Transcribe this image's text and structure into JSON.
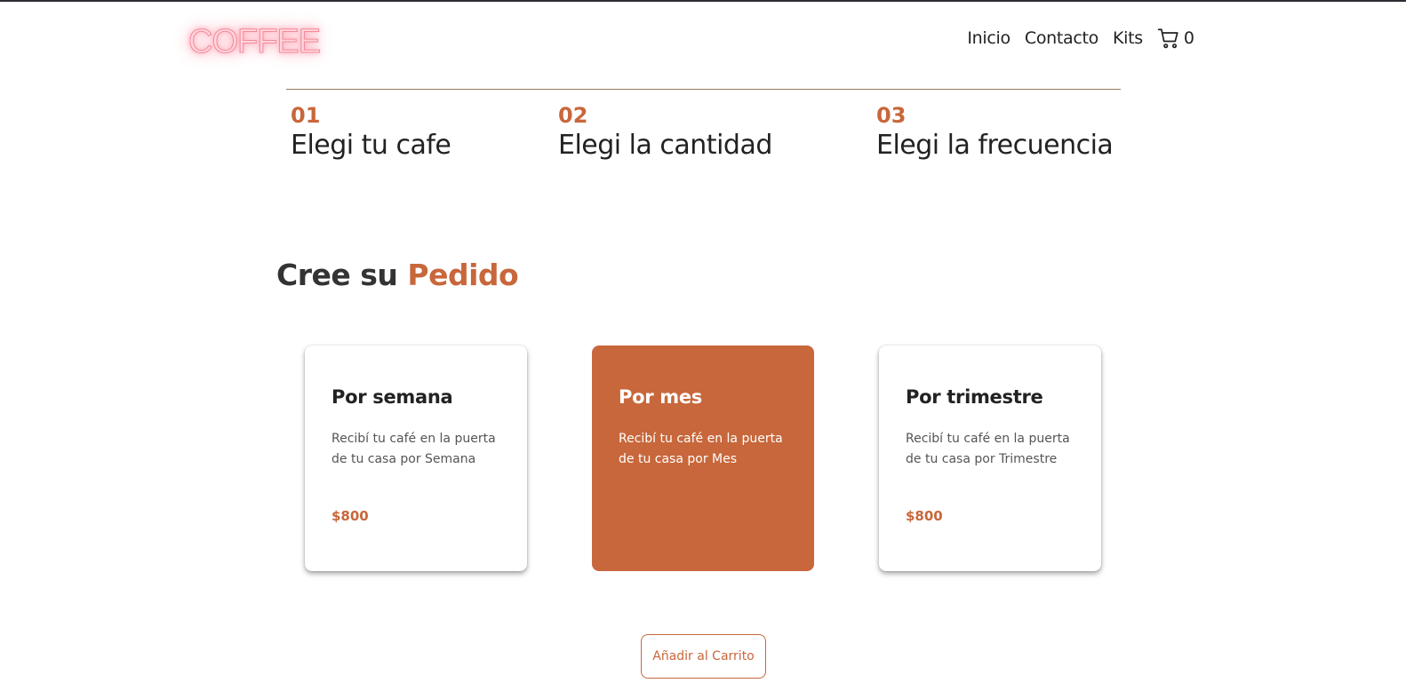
{
  "brand": {
    "logo_text": "COFFEE"
  },
  "nav": {
    "items": [
      {
        "label": "Inicio"
      },
      {
        "label": "Contacto"
      },
      {
        "label": "Kits"
      }
    ],
    "cart_icon": "shopping-cart-icon",
    "cart_count": "0"
  },
  "steps": [
    {
      "num": "01",
      "title": "Elegi tu cafe"
    },
    {
      "num": "02",
      "title": "Elegi la cantidad"
    },
    {
      "num": "03",
      "title": "Elegi la frecuencia"
    }
  ],
  "order_heading": {
    "prefix": "Cree su",
    "accent": "Pedido"
  },
  "plans": [
    {
      "title": "Por semana",
      "desc": "Recibí tu café en la puerta de tu casa por Semana",
      "price": "$800",
      "selected": false
    },
    {
      "title": "Por mes",
      "desc": "Recibí tu café en la puerta de tu casa por Mes",
      "price": "",
      "selected": true
    },
    {
      "title": "Por trimestre",
      "desc": "Recibí tu café en la puerta de tu casa por Trimestre",
      "price": "$800",
      "selected": false
    }
  ],
  "add_to_cart_label": "Añadir al Carrito",
  "colors": {
    "accent": "#c8673b",
    "text": "#222222",
    "rule": "#9a7a5c"
  }
}
